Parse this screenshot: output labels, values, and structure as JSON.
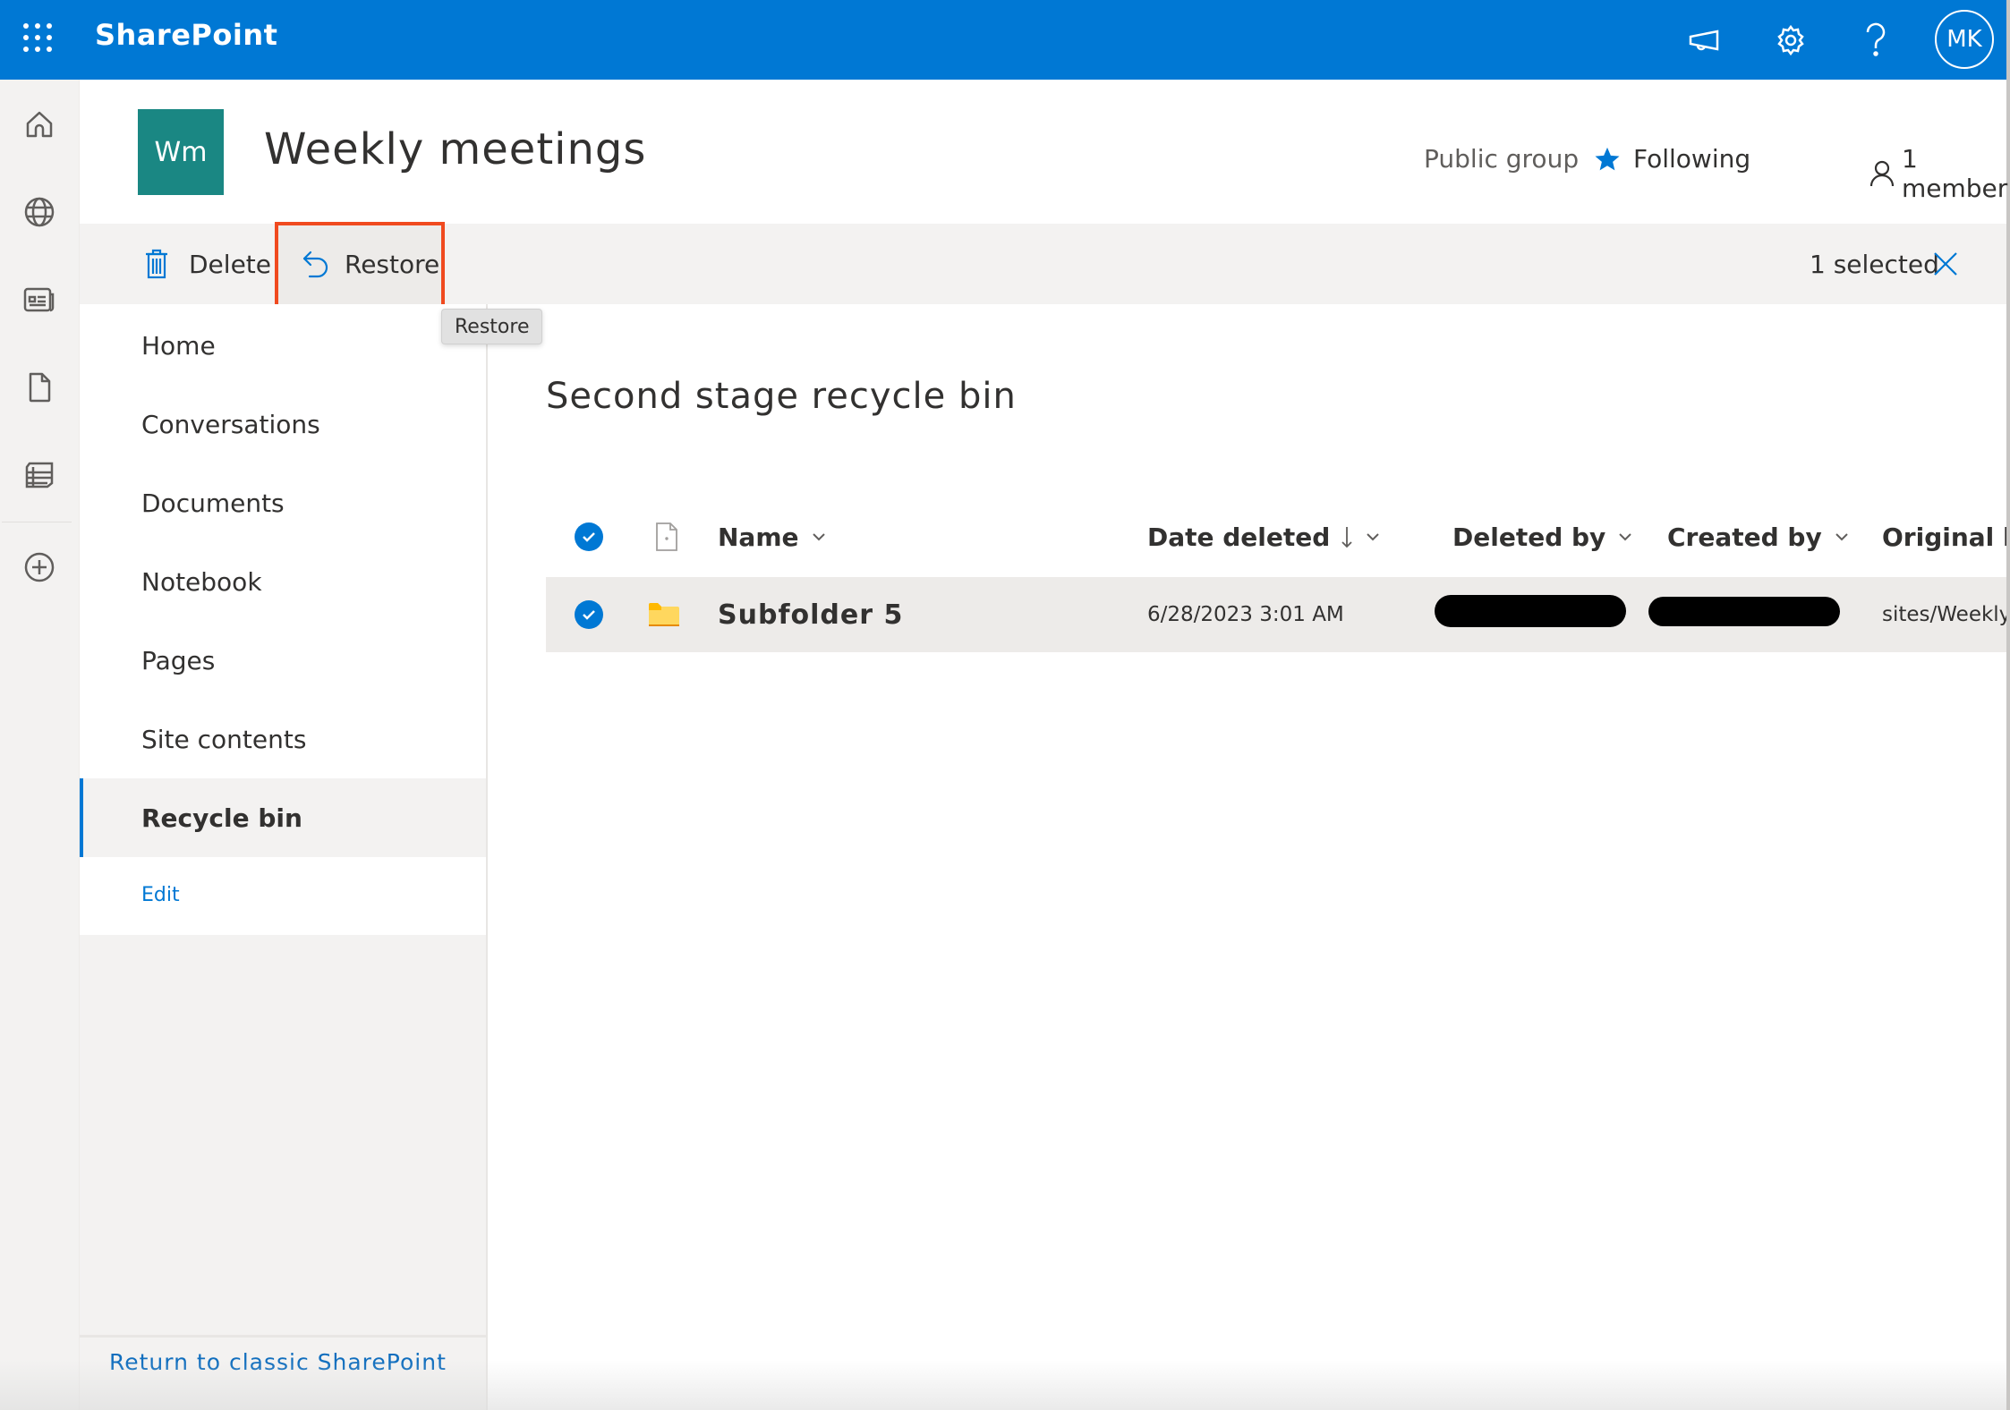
{
  "suitebar": {
    "app_name": "SharePoint",
    "avatar_initials": "MK",
    "icons": [
      "waffle-icon",
      "megaphone-icon",
      "gear-icon",
      "help-icon"
    ]
  },
  "rail": {
    "icons": [
      "home-icon",
      "globe-icon",
      "news-icon",
      "document-icon",
      "list-icon",
      "add-icon"
    ]
  },
  "site": {
    "logo_initials": "Wm",
    "title": "Weekly meetings",
    "visibility": "Public group",
    "following_label": "Following",
    "members_label": "1 member"
  },
  "commandbar": {
    "delete_label": "Delete",
    "restore_label": "Restore",
    "selected_label": "1 selected",
    "tooltip": "Restore"
  },
  "nav": {
    "items": [
      {
        "label": "Home"
      },
      {
        "label": "Conversations"
      },
      {
        "label": "Documents"
      },
      {
        "label": "Notebook"
      },
      {
        "label": "Pages"
      },
      {
        "label": "Site contents"
      },
      {
        "label": "Recycle bin",
        "selected": true
      }
    ],
    "edit_label": "Edit",
    "classic_link": "Return to classic SharePoint"
  },
  "main": {
    "heading": "Second stage recycle bin",
    "columns": {
      "name": "Name",
      "date_deleted": "Date deleted",
      "deleted_by": "Deleted by",
      "created_by": "Created by",
      "original_location": "Original lo"
    },
    "rows": [
      {
        "selected": true,
        "type": "folder",
        "name": "Subfolder 5",
        "date_deleted": "6/28/2023 3:01 AM",
        "deleted_by": "[redacted]",
        "created_by": "[redacted]",
        "original_location": "sites/Weeklyn"
      }
    ]
  },
  "colors": {
    "brand": "#0078d4",
    "site_logo": "#1a8783",
    "highlight": "#f04a1f",
    "star": "#0078d4"
  }
}
